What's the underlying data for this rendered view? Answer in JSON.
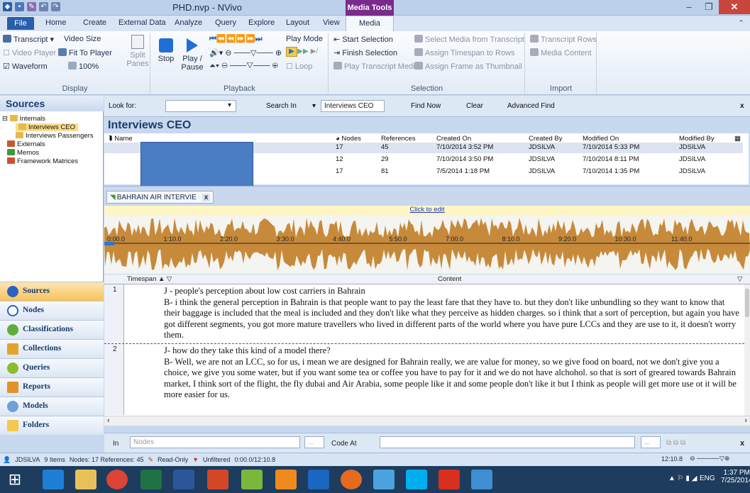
{
  "window": {
    "title": "PHD.nvp - NVivo",
    "context_tab": "Media Tools"
  },
  "tabs": [
    "File",
    "Home",
    "Create",
    "External Data",
    "Analyze",
    "Query",
    "Explore",
    "Layout",
    "View",
    "Media"
  ],
  "ribbon": {
    "display": {
      "transcript": "Transcript",
      "video_size": "Video Size",
      "video_player": "Video Player",
      "fit_to_player": "Fit To Player",
      "waveform": "Waveform",
      "zoom": "100%",
      "split_panes": "Split Panes",
      "label": "Display"
    },
    "playback": {
      "stop": "Stop",
      "play_pause": "Play / Pause",
      "play_mode": "Play Mode",
      "loop": "Loop",
      "label": "Playback"
    },
    "selection": {
      "start": "Start Selection",
      "finish": "Finish Selection",
      "play_transcript": "Play Transcript Media",
      "select_media": "Select Media from Transcript",
      "assign_timespan": "Assign Timespan to Rows",
      "assign_frame": "Assign Frame as Thumbnail",
      "label": "Selection"
    },
    "import": {
      "transcript_rows": "Transcript Rows",
      "media_content": "Media Content",
      "label": "Import"
    }
  },
  "sources": {
    "header": "Sources",
    "tree": {
      "internals": "Internals",
      "interviews_ceo": "Interviews CEO",
      "interviews_passengers": "Interviews Passengers",
      "externals": "Externals",
      "memos": "Memos",
      "framework": "Framework Matrices"
    },
    "nav": [
      "Sources",
      "Nodes",
      "Classifications",
      "Collections",
      "Queries",
      "Reports",
      "Models",
      "Folders"
    ]
  },
  "find": {
    "look_for": "Look for:",
    "search_in": "Search In",
    "scope": "Interviews CEO",
    "find_now": "Find Now",
    "clear": "Clear",
    "advanced": "Advanced Find"
  },
  "list": {
    "title": "Interviews CEO",
    "columns": [
      "Name",
      "Nodes",
      "References",
      "Created On",
      "Created By",
      "Modified On",
      "Modified By"
    ],
    "rows": [
      {
        "nodes": "17",
        "refs": "45",
        "created": "7/10/2014 3:52 PM",
        "by": "JDSILVA",
        "modified": "7/10/2014 5:33 PM",
        "mby": "JDSILVA"
      },
      {
        "nodes": "12",
        "refs": "29",
        "created": "7/10/2014 3:50 PM",
        "by": "JDSILVA",
        "modified": "7/10/2014 8:11 PM",
        "mby": "JDSILVA"
      },
      {
        "nodes": "17",
        "refs": "81",
        "created": "7/5/2014 1:18 PM",
        "by": "JDSILVA",
        "modified": "7/10/2014 1:35 PM",
        "mby": "JDSILVA"
      }
    ]
  },
  "doc_tab": "BAHRAIN AIR INTERVIE",
  "click_to_edit": "Click to edit",
  "timeline": [
    "0:00.0",
    "1:10.0",
    "2:20.0",
    "3:30.0",
    "4:40.0",
    "5:50.0",
    "7:00.0",
    "8:10.0",
    "9:20.0",
    "10:30.0",
    "11:40.0"
  ],
  "transcript": {
    "col_timespan": "Timespan",
    "col_content": "Content",
    "rows": [
      {
        "n": "1",
        "lines": [
          "J - people's perception about low cost carriers in Bahrain",
          "B- i think the general perception in Bahrain is that people want to pay the least fare that they have to.  but they don't like unbundling so they want to know that their baggage is included that the meal is included and they don't like what they perceive as hidden charges.  so i think that a sort of perception, but again you have got different segments, you got more mature travellers who lived in different parts of the world where you have pure LCCs and they are use to it, it doesn't worry them."
        ]
      },
      {
        "n": "2",
        "lines": [
          "J- how do they take this kind of a model there?",
          "B- Well, we are not an LCC, so for us, i mean we are designed for Bahrain really, we are value for money, so we give food on board, not we don't give you a choice, we give you some water, but if you want some tea or coffee you have to pay for it and we do not have alchohol.  so that is sort of greared towards Bahrain market, I think sort of the flight, the fly dubai and Air Arabia, some people like it and some people don't like it but I think as people will get more use ot it will be more easier for us."
        ]
      }
    ]
  },
  "coding": {
    "in": "In",
    "nodes_placeholder": "Nodes",
    "code_at": "Code At"
  },
  "status": {
    "user": "JDSILVA",
    "items": "9 Items",
    "nodes": "Nodes: 17 References: 45",
    "readonly": "Read-Only",
    "unfiltered": "Unfiltered",
    "time": "0:00.0/12:10.8",
    "pos": "12:10.8"
  },
  "taskbar": {
    "lang": "ENG",
    "time": "1:37 PM",
    "date": "7/25/2014"
  }
}
